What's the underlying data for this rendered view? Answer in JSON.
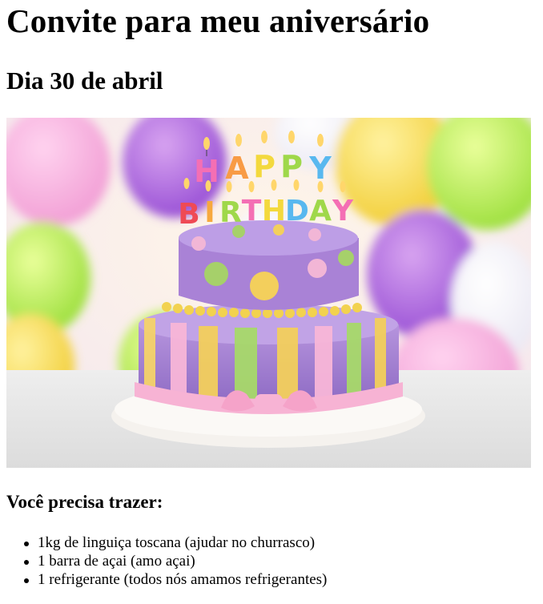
{
  "page": {
    "title": "Convite para meu aniversário",
    "date": "Dia 30 de abril",
    "bring_heading": "Você precisa trazer:",
    "items": [
      "1kg de linguiça toscana (ajudar no churrasco)",
      "1 barra de açai (amo açai)",
      "1 refrigerante (todos nós amamos refrigerantes)"
    ]
  },
  "image": {
    "candle_letters_top": "HAPPY",
    "candle_letters_bottom": "BIRTHDAY"
  }
}
